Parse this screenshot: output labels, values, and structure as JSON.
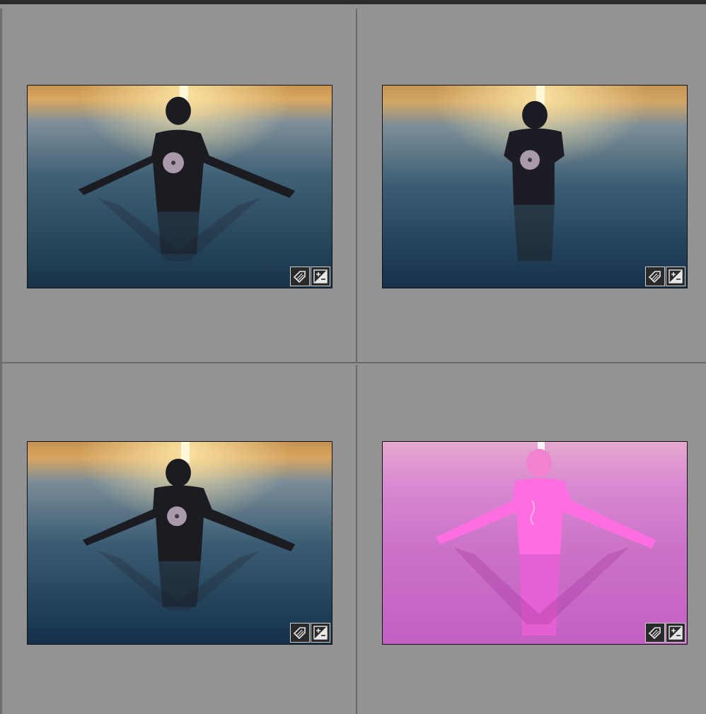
{
  "grid": {
    "cells": [
      {
        "id": "photo-1",
        "variant": "arms-spread-sunset",
        "adjusted": true,
        "keyworded": true
      },
      {
        "id": "photo-2",
        "variant": "arms-hugging-sunset",
        "adjusted": true,
        "keyworded": true
      },
      {
        "id": "photo-3",
        "variant": "arms-spread-sunset",
        "adjusted": true,
        "keyworded": true
      },
      {
        "id": "photo-4",
        "variant": "arms-spread-magenta-mask",
        "adjusted": true,
        "keyworded": true
      }
    ]
  },
  "icons": {
    "keyword_badge": "tag-icon",
    "develop_badge": "exposure-adjustment-icon"
  },
  "colors": {
    "panel_bg": "#939393",
    "cell_divider": "#6a6a6a",
    "thumb_border": "#111111",
    "mask_overlay": "#e040c8"
  }
}
